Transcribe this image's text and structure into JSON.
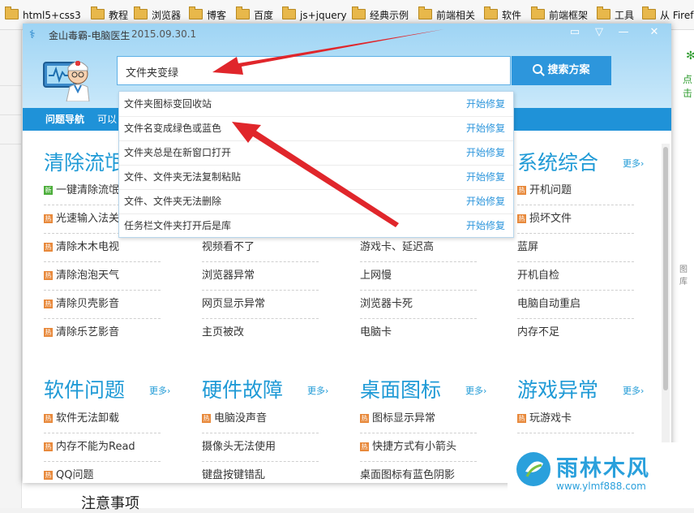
{
  "bookmarks": [
    {
      "label": "html5+css3"
    },
    {
      "label": "教程"
    },
    {
      "label": "浏览器"
    },
    {
      "label": "博客"
    },
    {
      "label": "百度"
    },
    {
      "label": "js+jquery"
    },
    {
      "label": "经典示例"
    },
    {
      "label": "前端相关"
    },
    {
      "label": "软件"
    },
    {
      "label": "前端框架"
    },
    {
      "label": "工具"
    },
    {
      "label": "从 Firef"
    }
  ],
  "background_page": {
    "right_label": "点击",
    "side_text": "图库",
    "bottom_heading": "注意事项"
  },
  "window": {
    "title": "金山毒霸-电脑医生",
    "version": "2015.09.30.1",
    "controls": [
      "▭",
      "▽",
      "—",
      "✕"
    ]
  },
  "search": {
    "value": "文件夹变绿",
    "button_label": "搜索方案"
  },
  "nav": {
    "items": [
      "问题导航",
      "可以"
    ]
  },
  "suggestions": [
    {
      "text": "文件夹图标变回收站",
      "action": "开始修复"
    },
    {
      "text": "文件名变成绿色或蓝色",
      "action": "开始修复"
    },
    {
      "text": "文件夹总是在新窗口打开",
      "action": "开始修复"
    },
    {
      "text": "文件、文件夹无法复制粘贴",
      "action": "开始修复"
    },
    {
      "text": "文件、文件夹无法删除",
      "action": "开始修复"
    },
    {
      "text": "任务栏文件夹打开后是库",
      "action": "开始修复"
    }
  ],
  "sections": {
    "more_label": "更多›",
    "row1": [
      {
        "title": "清除流氓",
        "links": [
          {
            "text": "一键清除流氓",
            "tag": "新"
          },
          {
            "text": "光速输入法关",
            "tag": "热"
          },
          {
            "text": "清除木木电视",
            "tag": "热"
          },
          {
            "text": "清除泡泡天气",
            "tag": "热"
          },
          {
            "text": "清除贝壳影音",
            "tag": "热"
          },
          {
            "text": "清除乐艺影音",
            "tag": "热"
          }
        ]
      },
      {
        "title": "",
        "links": [
          {
            "text": "",
            "tag": ""
          },
          {
            "text": "",
            "tag": ""
          },
          {
            "text": "视频看不了",
            "tag": ""
          },
          {
            "text": "浏览器异常",
            "tag": ""
          },
          {
            "text": "网页显示异常",
            "tag": ""
          },
          {
            "text": "主页被改",
            "tag": ""
          }
        ]
      },
      {
        "title": "",
        "links": [
          {
            "text": "",
            "tag": ""
          },
          {
            "text": "",
            "tag": ""
          },
          {
            "text": "游戏卡、延迟高",
            "tag": ""
          },
          {
            "text": "上网慢",
            "tag": ""
          },
          {
            "text": "浏览器卡死",
            "tag": ""
          },
          {
            "text": "电脑卡",
            "tag": ""
          }
        ]
      },
      {
        "title": "系统综合",
        "links": [
          {
            "text": "开机问题",
            "tag": "热"
          },
          {
            "text": "损坏文件",
            "tag": "热"
          },
          {
            "text": "蓝屏",
            "tag": ""
          },
          {
            "text": "开机自检",
            "tag": ""
          },
          {
            "text": "电脑自动重启",
            "tag": ""
          },
          {
            "text": "内存不足",
            "tag": ""
          }
        ]
      }
    ],
    "row2": [
      {
        "title": "软件问题",
        "links": [
          {
            "text": "软件无法卸载",
            "tag": "热"
          },
          {
            "text": "内存不能为Read",
            "tag": "热"
          },
          {
            "text": "QQ问题",
            "tag": "热"
          }
        ]
      },
      {
        "title": "硬件故障",
        "links": [
          {
            "text": "电脑没声音",
            "tag": "热"
          },
          {
            "text": "摄像头无法使用",
            "tag": ""
          },
          {
            "text": "键盘按键错乱",
            "tag": ""
          }
        ]
      },
      {
        "title": "桌面图标",
        "links": [
          {
            "text": "图标显示异常",
            "tag": "热"
          },
          {
            "text": "快捷方式有小箭头",
            "tag": "热"
          },
          {
            "text": "桌面图标有蓝色阴影",
            "tag": ""
          }
        ]
      },
      {
        "title": "游戏异常",
        "links": [
          {
            "text": "玩游戏卡",
            "tag": "热"
          },
          {
            "text": "",
            "tag": ""
          },
          {
            "text": "",
            "tag": ""
          }
        ]
      }
    ]
  },
  "watermark": {
    "brand": "雨林木风",
    "url": "www.ylmf888.com"
  },
  "colors": {
    "accent": "#1f9ad6",
    "nav_bg": "#1f92d8",
    "search_button": "#2d96dc",
    "hot_tag": "#e8893b",
    "new_tag": "#4cae3b",
    "arrow": "#e0262b"
  }
}
